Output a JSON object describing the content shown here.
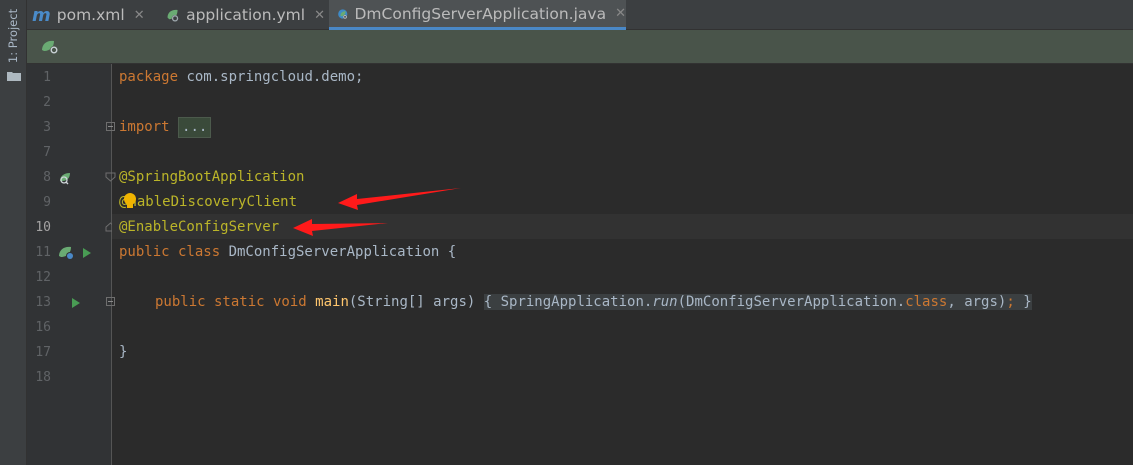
{
  "sidebar": {
    "project_tab": "1: Project",
    "folder_icon": "folder-icon"
  },
  "tabs": [
    {
      "label": "pom.xml",
      "icon": "maven-icon",
      "icon_text": "m",
      "active": false
    },
    {
      "label": "application.yml",
      "icon": "spring-config-icon",
      "active": false
    },
    {
      "label": "DmConfigServerApplication.java",
      "icon": "spring-boot-class-icon",
      "active": true
    }
  ],
  "toolbar": {
    "icon": "spring-boot-icon"
  },
  "editor": {
    "current_line": 10,
    "line_numbers": [
      "1",
      "2",
      "3",
      "7",
      "8",
      "9",
      "10",
      "11",
      "12",
      "13",
      "16",
      "17",
      "18"
    ],
    "lines": {
      "l1_kw": "package",
      "l1_rest": " com.springcloud.demo;",
      "l3_kw": "import ",
      "l3_fold": "...",
      "l8": "@SpringBootApplication",
      "l9_at": "@",
      "l9_rest": "nableDiscoveryClient",
      "l10": "@EnableConfigServer",
      "l11_kw": "public class ",
      "l11_rest": "DmConfigServerApplication {",
      "l13_kw": "public static void ",
      "l13_fn": "main",
      "l13_args": "(String[] args) ",
      "l13_body_open": "{ ",
      "l13_body_a": "SpringApplication.",
      "l13_body_run": "run",
      "l13_body_b": "(DmConfigServerApplication.",
      "l13_body_class": "class",
      "l13_body_c": ", args)",
      "l13_semi": ";",
      "l13_body_close": " }",
      "l17": "}"
    }
  },
  "colors": {
    "background": "#2b2b2b",
    "keyword": "#cc7832",
    "annotation": "#bbb529",
    "method": "#ffc66d",
    "text": "#a9b7c6",
    "arrow": "#ff1a1a"
  }
}
